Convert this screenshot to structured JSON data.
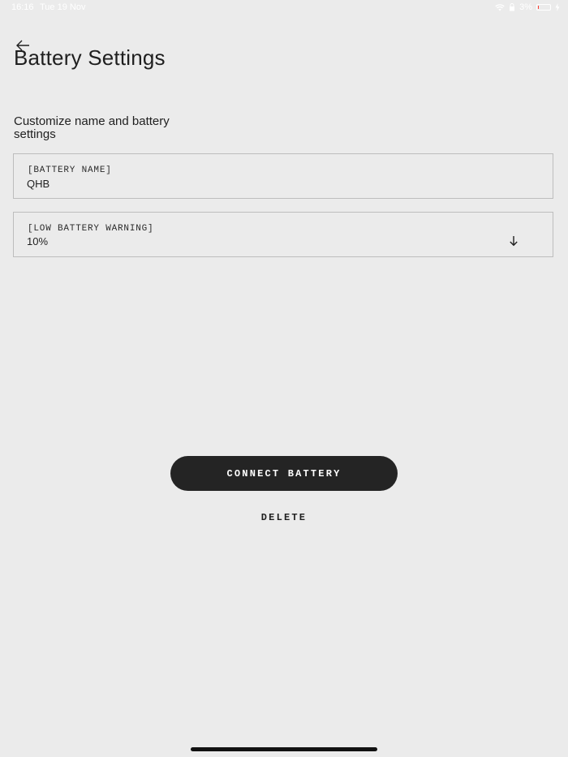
{
  "status_bar": {
    "time": "16:16",
    "date": "Tue 19 Nov",
    "battery_percent": "3%",
    "battery_level": 0.03
  },
  "header": {
    "title": "Battery Settings",
    "back_icon": "arrow-left-icon"
  },
  "subtitle": "Customize name and battery settings",
  "fields": {
    "battery_name": {
      "label": "[BATTERY NAME]",
      "value": "QHB"
    },
    "low_battery_warning": {
      "label": "[LOW BATTERY WARNING]",
      "value": "10%",
      "icon": "arrow-down-icon"
    }
  },
  "actions": {
    "connect_label": "CONNECT BATTERY",
    "delete_label": "DELETE"
  },
  "colors": {
    "background": "#ebebeb",
    "primary_button": "#242424",
    "primary_button_text": "#ffffff",
    "text": "#1f1f1f",
    "field_border": "#bdbdbd"
  }
}
